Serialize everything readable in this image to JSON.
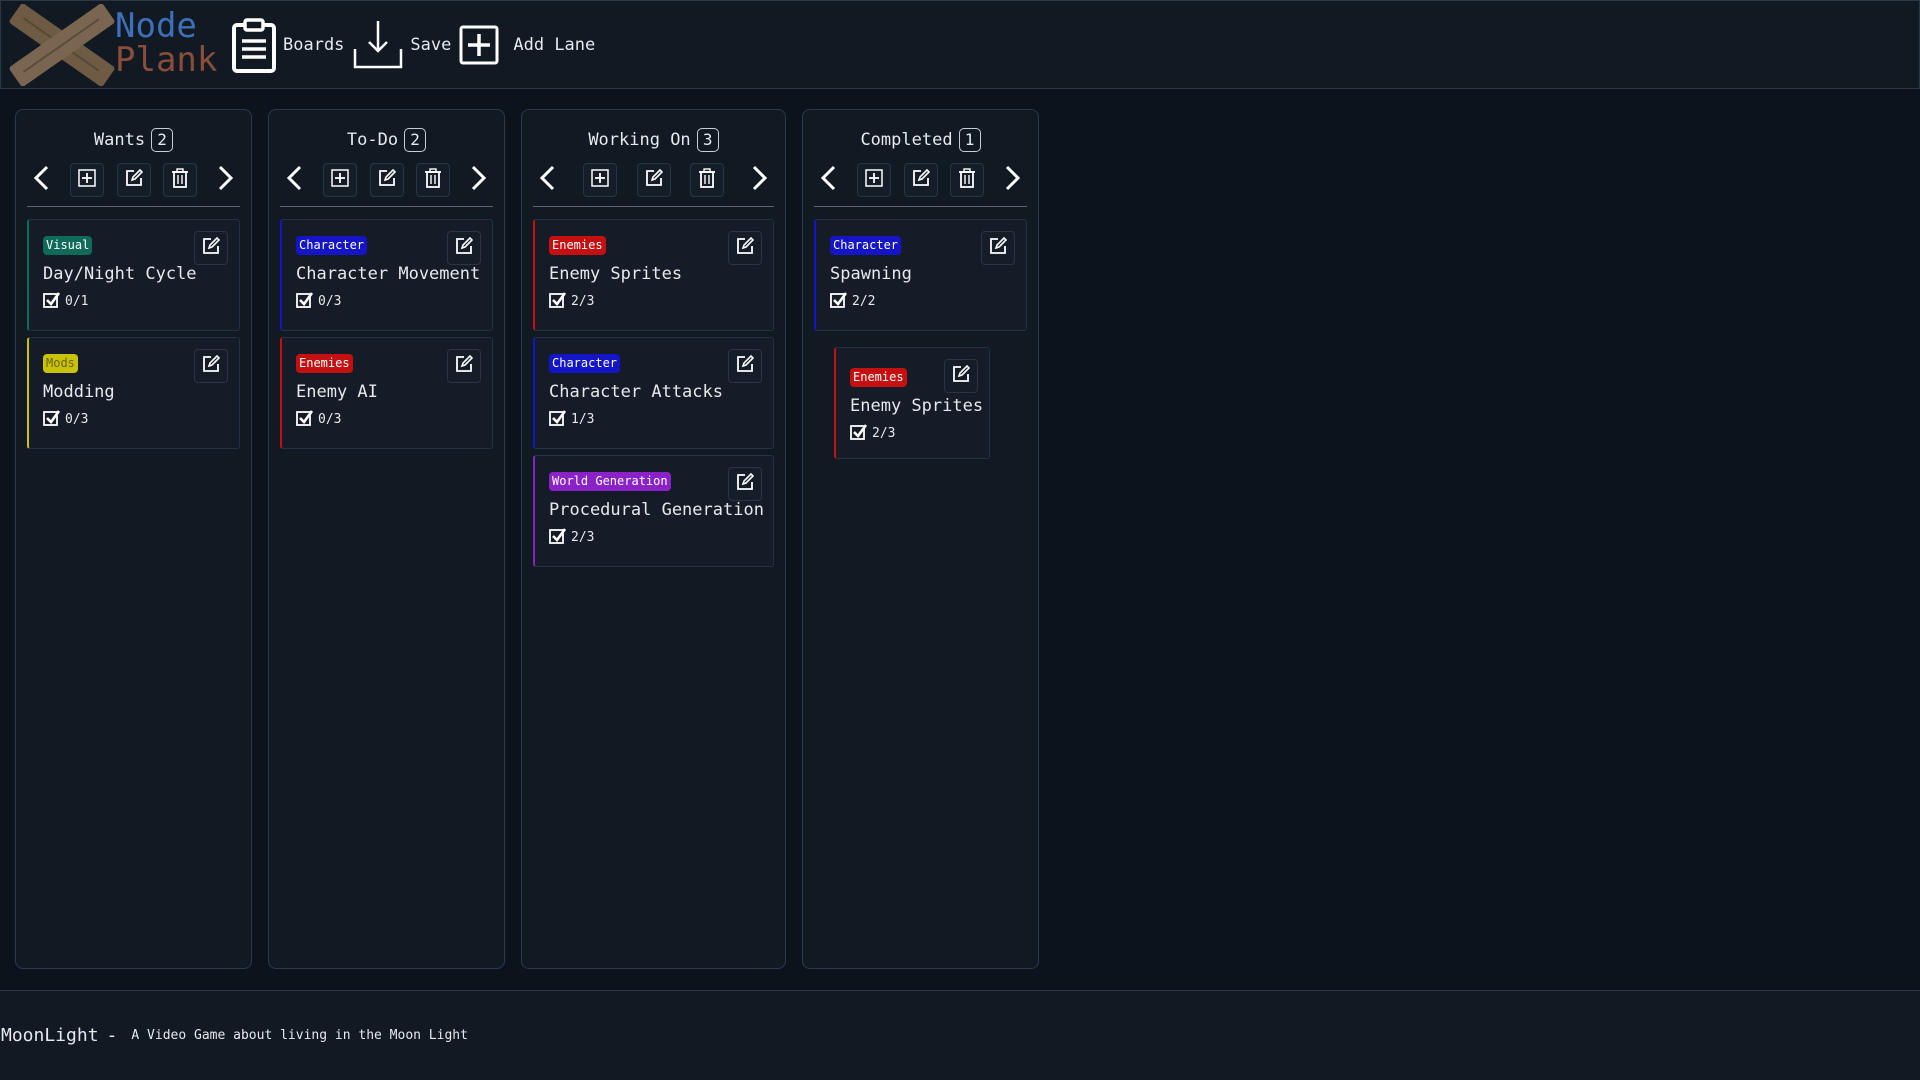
{
  "app": {
    "logo_line1": "Node",
    "logo_line2": "Plank"
  },
  "toolbar": {
    "boards_label": "Boards",
    "save_label": "Save",
    "add_lane_label": "Add Lane"
  },
  "colors": {
    "tag_visual": "#0f6a5a",
    "tag_mods": "#c9c20a",
    "tag_character": "#1515c8",
    "tag_enemies": "#c41010",
    "tag_world_generation": "#8a22c8"
  },
  "lanes": [
    {
      "title": "Wants",
      "count": "2",
      "cards": [
        {
          "tag": "Visual",
          "title": "Day/Night Cycle",
          "progress": "0/1"
        },
        {
          "tag": "Mods",
          "title": "Modding",
          "progress": "0/3"
        }
      ]
    },
    {
      "title": "To-Do",
      "count": "2",
      "cards": [
        {
          "tag": "Character",
          "title": "Character Movement",
          "progress": "0/3"
        },
        {
          "tag": "Enemies",
          "title": "Enemy AI",
          "progress": "0/3"
        }
      ]
    },
    {
      "title": "Working On",
      "count": "3",
      "cards": [
        {
          "tag": "Enemies",
          "title": "Enemy Sprites",
          "progress": "2/3"
        },
        {
          "tag": "Character",
          "title": "Character Attacks",
          "progress": "1/3"
        },
        {
          "tag": "World Generation",
          "title": "Procedural Generation",
          "progress": "2/3"
        }
      ]
    },
    {
      "title": "Completed",
      "count": "1",
      "cards": [
        {
          "tag": "Character",
          "title": "Spawning",
          "progress": "2/2"
        },
        {
          "tag": "Enemies",
          "title": "Enemy Sprites",
          "progress": "2/3"
        }
      ]
    }
  ],
  "footer": {
    "board_name": "MoonLight",
    "separator": "-",
    "description": "A Video Game about living in the Moon Light"
  }
}
